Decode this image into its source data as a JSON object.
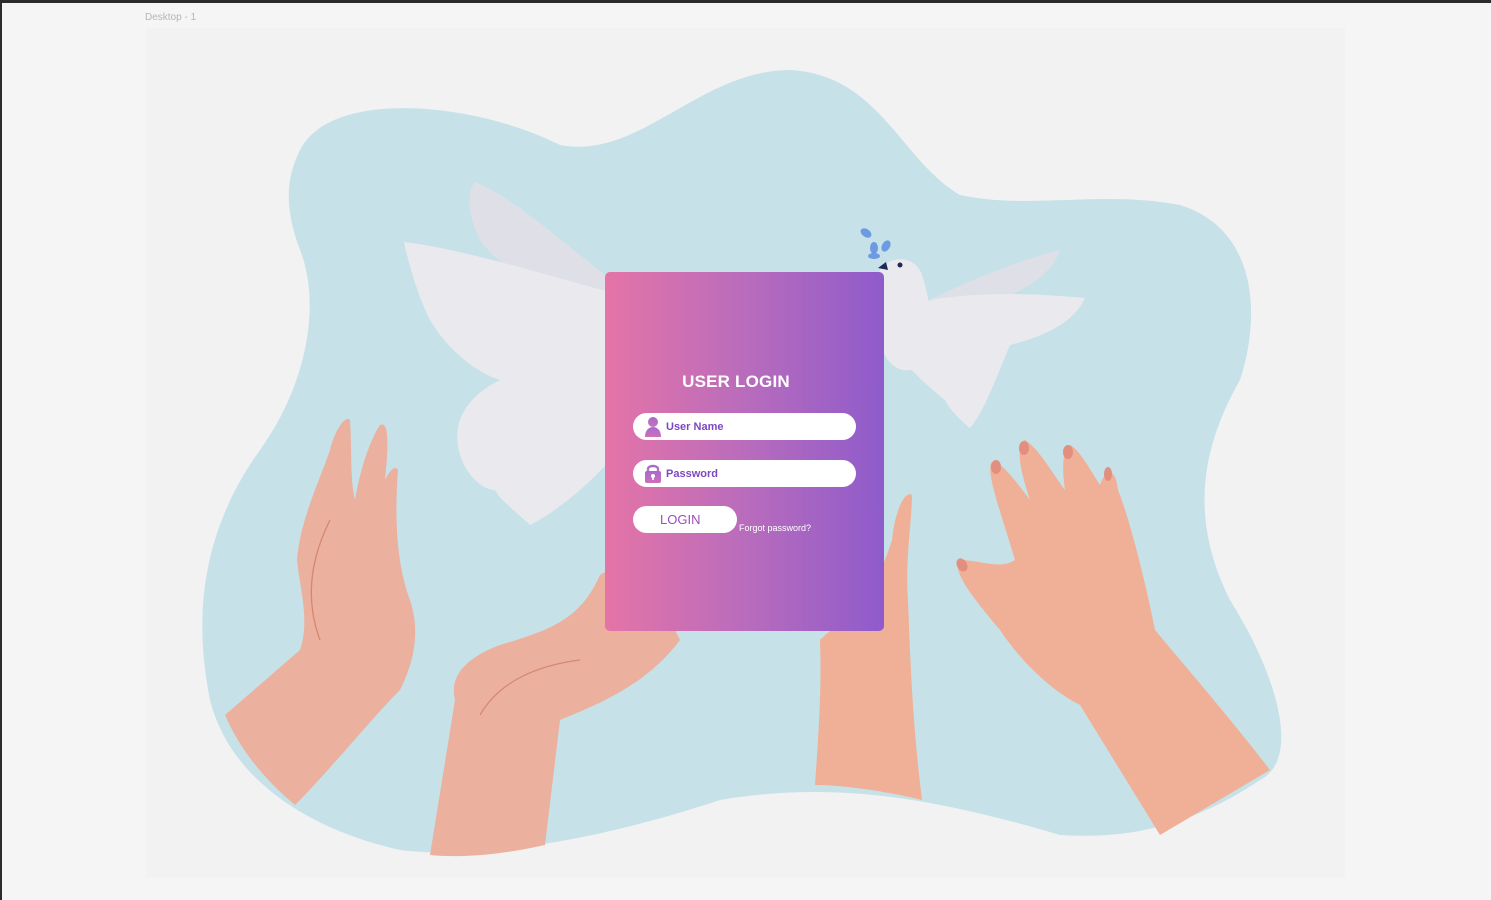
{
  "frame": {
    "label": "Desktop - 1"
  },
  "login": {
    "title": "USER LOGIN",
    "username_placeholder": "User Name",
    "password_placeholder": "Password",
    "login_label": "LOGIN",
    "forgot_label": "Forgot password?"
  },
  "colors": {
    "card_gradient_start": "#e574a7",
    "card_gradient_end": "#8e5bcb",
    "blob": "#c6e2e8",
    "accent_text": "#7b47c3"
  },
  "icons": {
    "username": "user-icon",
    "password": "lock-icon",
    "illustration": "dove-and-hands"
  }
}
